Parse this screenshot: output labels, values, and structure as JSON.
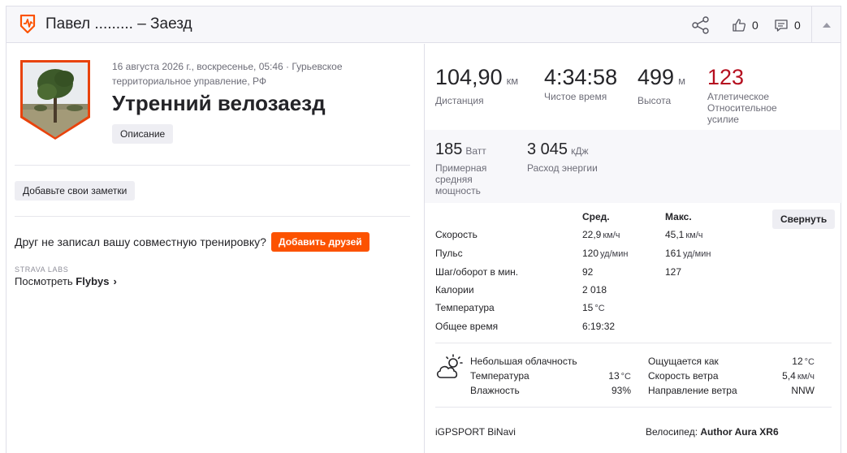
{
  "header": {
    "title": "Павел ......... – Заезд",
    "kudos_count": "0",
    "comments_count": "0"
  },
  "activity": {
    "meta": "16 августа 2026 г., воскресенье, 05:46 · Гурьевское территориальное управление, РФ",
    "title": "Утренний велозаезд",
    "description_button": "Описание",
    "notes_button": "Добавьте свои заметки",
    "friend_prompt": "Друг не записал вашу совместную тренировку?",
    "add_friends_button": "Добавить друзей",
    "labs_caption": "STRAVA LABS",
    "flybys_prefix": "Посмотреть",
    "flybys_label": "Flybys",
    "flybys_chevron": "›"
  },
  "stats": {
    "distance": {
      "value": "104,90",
      "unit": "км",
      "label": "Дистанция"
    },
    "moving_time": {
      "value": "4:34:58",
      "label": "Чистое время"
    },
    "elevation": {
      "value": "499",
      "unit": "м",
      "label": "Высота"
    },
    "relative_effort": {
      "value": "123",
      "label": "Атлетическое Относительное усилие"
    },
    "power": {
      "value": "185",
      "unit": "Ватт",
      "label": "Примерная средняя мощность"
    },
    "energy": {
      "value": "3 045",
      "unit": "кДж",
      "label": "Расход энергии"
    }
  },
  "details": {
    "col_avg": "Сред.",
    "col_max": "Макс.",
    "collapse_button": "Свернуть",
    "rows": [
      {
        "label": "Скорость",
        "avg": "22,9",
        "avg_unit": "км/ч",
        "max": "45,1",
        "max_unit": "км/ч"
      },
      {
        "label": "Пульс",
        "avg": "120",
        "avg_unit": "уд/мин",
        "max": "161",
        "max_unit": "уд/мин"
      },
      {
        "label": "Шаг/оборот в мин.",
        "avg": "92",
        "avg_unit": "",
        "max": "127",
        "max_unit": ""
      },
      {
        "label": "Калории",
        "avg": "2 018",
        "avg_unit": "",
        "max": "",
        "max_unit": ""
      },
      {
        "label": "Температура",
        "avg": "15",
        "avg_unit": "°C",
        "max": "",
        "max_unit": ""
      },
      {
        "label": "Общее время",
        "avg": "6:19:32",
        "avg_unit": "",
        "max": "",
        "max_unit": ""
      }
    ]
  },
  "weather": {
    "icon": "partly-cloudy-icon",
    "condition": "Небольшая облачность",
    "temperature_label": "Температура",
    "temperature_value": "13",
    "temperature_unit": "°C",
    "humidity_label": "Влажность",
    "humidity_value": "93%",
    "feels_like_label": "Ощущается как",
    "feels_like_value": "12",
    "feels_like_unit": "°C",
    "wind_speed_label": "Скорость ветра",
    "wind_speed_value": "5,4",
    "wind_speed_unit": "км/ч",
    "wind_dir_label": "Направление ветра",
    "wind_dir_value": "NNW"
  },
  "equipment": {
    "device": "iGPSPORT BiNavi",
    "bike_label": "Велосипед:",
    "bike_name": "Author Aura XR6"
  },
  "colors": {
    "brand_orange": "#fc5200",
    "effort_red": "#b50f1f",
    "muted_text": "#6d6d78",
    "band_grey": "#f7f7fa"
  }
}
